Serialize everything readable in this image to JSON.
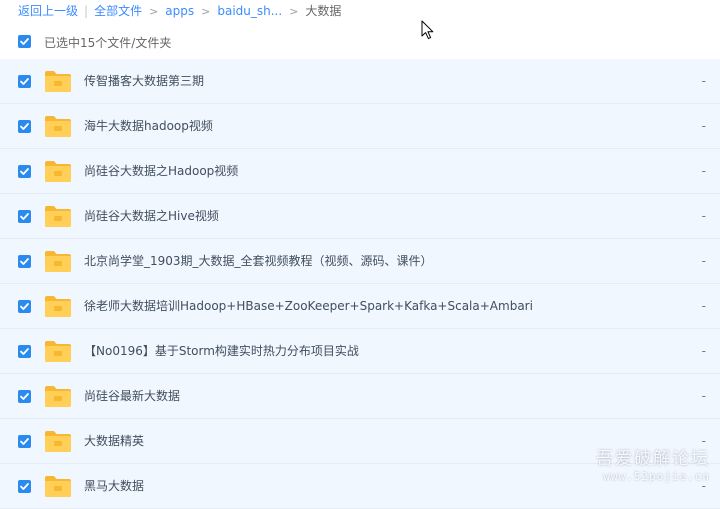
{
  "breadcrumb": {
    "back": "返回上一级",
    "divider": "|",
    "all_files": "全部文件",
    "apps": "apps",
    "baidu": "baidu_sh...",
    "current": "大数据",
    "arrow": ">"
  },
  "selection": {
    "text": "已选中15个文件/文件夹",
    "checked": true
  },
  "files": [
    {
      "name": "传智播客大数据第三期",
      "size": "-"
    },
    {
      "name": "海牛大数据hadoop视频",
      "size": "-"
    },
    {
      "name": "尚硅谷大数据之Hadoop视频",
      "size": "-"
    },
    {
      "name": "尚硅谷大数据之Hive视频",
      "size": "-"
    },
    {
      "name": "北京尚学堂_1903期_大数据_全套视频教程（视频、源码、课件）",
      "size": "-"
    },
    {
      "name": "徐老师大数据培训Hadoop+HBase+ZooKeeper+Spark+Kafka+Scala+Ambari",
      "size": "-"
    },
    {
      "name": "【No0196】基于Storm构建实时热力分布项目实战",
      "size": "-"
    },
    {
      "name": "尚硅谷最新大数据",
      "size": "-"
    },
    {
      "name": "大数据精英",
      "size": "-"
    },
    {
      "name": "黑马大数据",
      "size": "-"
    }
  ],
  "icons": {
    "checkbox": "checkbox-checked-icon",
    "folder": "folder-icon",
    "cursor": "mouse-pointer-icon"
  },
  "colors": {
    "link": "#3b8cff",
    "checkbox": "#2b8aee",
    "row_selected": "#f0f7fe",
    "folder": "#ffc94c"
  },
  "watermark": {
    "title": "吾爱破解论坛",
    "url": "www.52pojie.cn"
  }
}
